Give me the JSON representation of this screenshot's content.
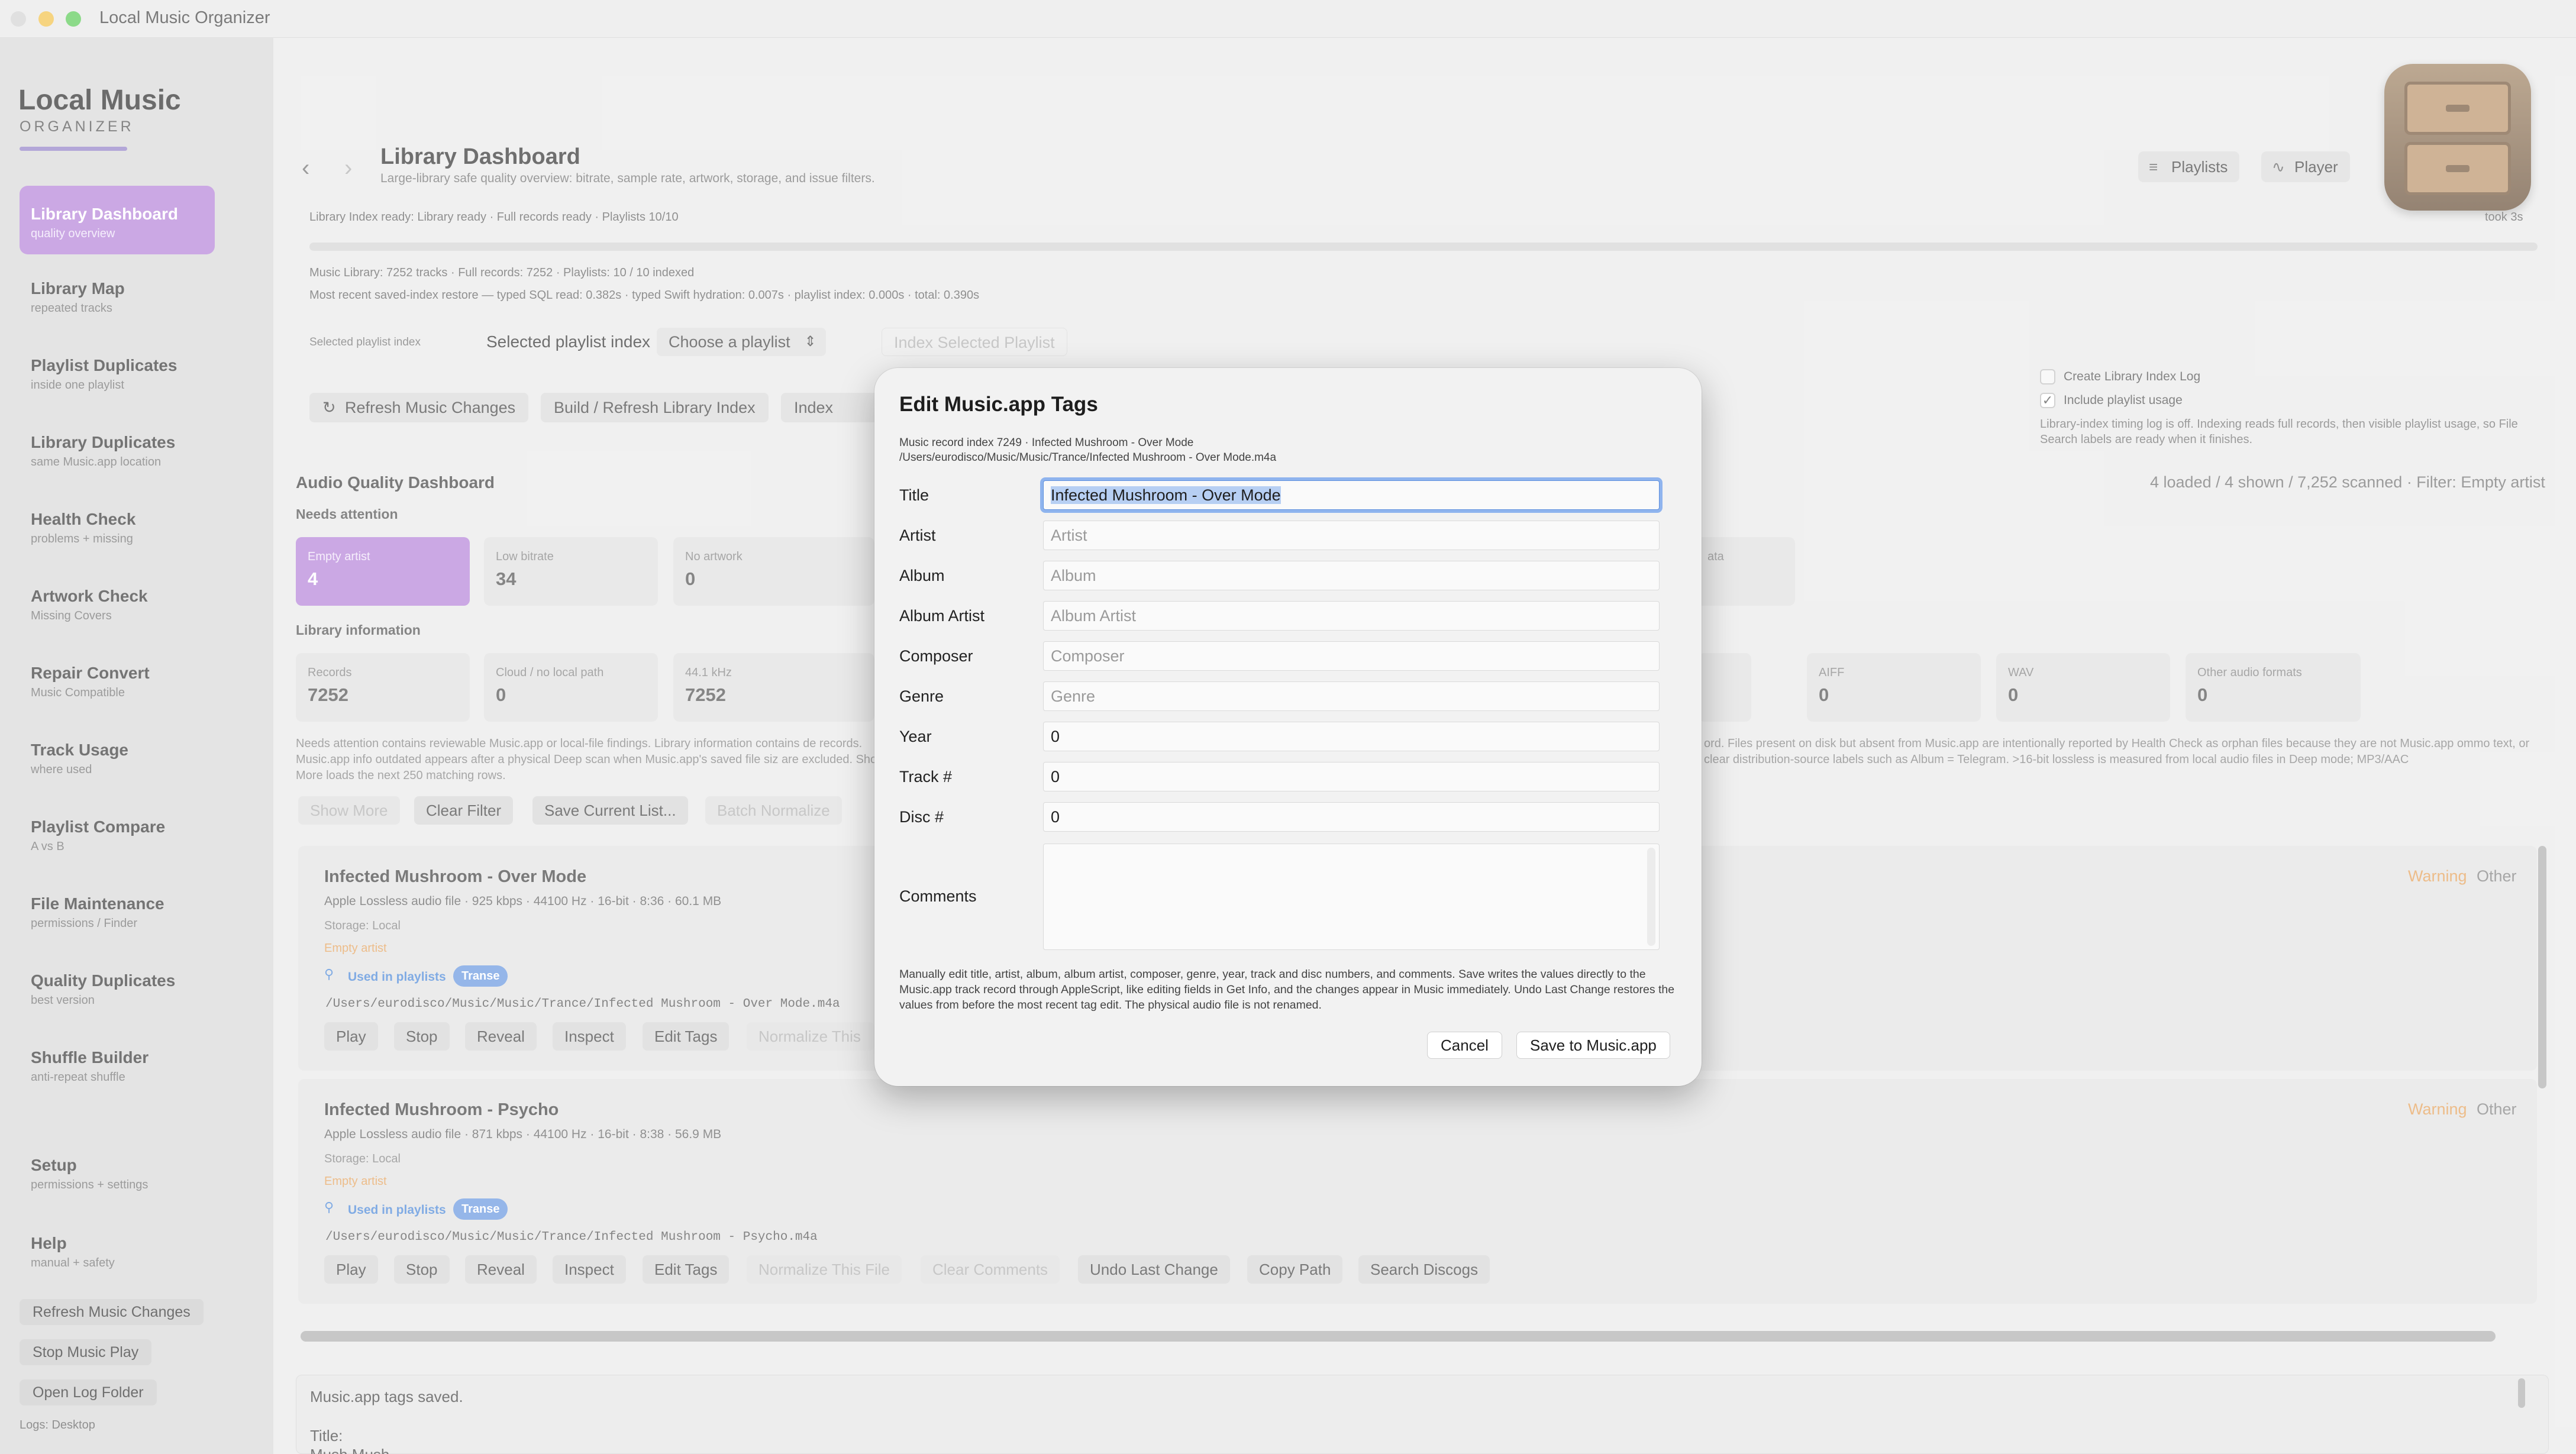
{
  "window": {
    "title": "Local Music Organizer"
  },
  "sidebar": {
    "brand_title": "Local Music",
    "brand_subtitle": "ORGANIZER",
    "items": [
      {
        "label": "Library Dashboard",
        "sub": "quality overview",
        "active": true
      },
      {
        "label": "Library Map",
        "sub": "repeated tracks"
      },
      {
        "label": "Playlist Duplicates",
        "sub": "inside one playlist"
      },
      {
        "label": "Library Duplicates",
        "sub": "same Music.app location"
      },
      {
        "label": "Health Check",
        "sub": "problems + missing"
      },
      {
        "label": "Artwork Check",
        "sub": "Missing Covers"
      },
      {
        "label": "Repair Convert",
        "sub": "Music Compatible"
      },
      {
        "label": "Track Usage",
        "sub": "where used"
      },
      {
        "label": "Playlist Compare",
        "sub": "A vs B"
      },
      {
        "label": "File Maintenance",
        "sub": "permissions / Finder"
      },
      {
        "label": "Quality Duplicates",
        "sub": "best version"
      },
      {
        "label": "Shuffle Builder",
        "sub": "anti-repeat shuffle"
      },
      {
        "label": "Setup",
        "sub": "permissions + settings"
      },
      {
        "label": "Help",
        "sub": "manual + safety"
      }
    ],
    "buttons": [
      "Refresh Music Changes",
      "Stop Music Play",
      "Open Log Folder"
    ],
    "logs_label": "Logs: Desktop"
  },
  "header": {
    "back_glyph": "‹",
    "forward_glyph": "›",
    "title": "Library Dashboard",
    "subtitle": "Large-library safe quality overview: bitrate, sample rate, artwork, storage, and issue filters.",
    "playlists_btn": "Playlists",
    "player_btn": "Player",
    "playlists_icon": "playlist-icon",
    "player_icon": "waveform-icon"
  },
  "index": {
    "status": "Library Index ready: Library ready · Full records ready · Playlists 10/10",
    "took": "took 3s",
    "library_info": "Music Library: 7252 tracks · Full records: 7252 · Playlists: 10 / 10 indexed",
    "restore_info": "Most recent saved-index restore — typed SQL read: 0.382s · typed Swift hydration: 0.007s · playlist index: 0.000s · total: 0.390s",
    "selected_label_small": "Selected playlist index",
    "selected_label": "Selected playlist index",
    "playlist_select": "Choose a playlist",
    "index_selected_btn": "Index Selected Playlist",
    "refresh_btn": "Refresh Music Changes",
    "build_btn": "Build / Refresh Library Index",
    "index_playlists_btn": "Index Playli",
    "create_log": "Create Library Index Log",
    "include_usage": "Include playlist usage",
    "note": "Library-index timing log is off. Indexing reads full records, then visible playlist usage, so File Search labels are ready when it finishes."
  },
  "quality": {
    "title": "Audio Quality Dashboard",
    "right_status": "4 loaded / 4 shown / 7,252 scanned · Filter: Empty artist",
    "needs_attention": "Needs attention",
    "attention_cards": [
      {
        "label": "Empty artist",
        "value": "4"
      },
      {
        "label": "Low bitrate",
        "value": "34"
      },
      {
        "label": "No artwork",
        "value": "0"
      }
    ],
    "partial_card_label": "ata",
    "library_information": "Library information",
    "info_cards": [
      {
        "label": "Records",
        "value": "7252"
      },
      {
        "label": "Cloud / no local path",
        "value": "0"
      },
      {
        "label": "44.1 kHz",
        "value": "7252"
      }
    ],
    "info_cards_right": [
      {
        "label": "AIFF",
        "value": "0"
      },
      {
        "label": "WAV",
        "value": "0"
      },
      {
        "label": "Other audio formats",
        "value": "0"
      }
    ],
    "note_left": "Needs attention contains reviewable Music.app or local-file findings. Library information contains de records. Music.app info outdated appears after a physical Deep scan when Music.app's saved file siz are excluded. Show More loads the next 250 matching rows.",
    "note_right": "ord. Files present on disk but absent from Music.app are intentionally reported by Health Check as orphan files because they are not Music.app ommo text, or clear distribution-source labels such as Album = Telegram. >16-bit lossless is measured from local audio files in Deep mode; MP3/AAC",
    "show_more": "Show More",
    "clear_filter": "Clear Filter",
    "save_list": "Save Current List...",
    "batch_normalize": "Batch Normalize"
  },
  "tracks": [
    {
      "title": "Infected Mushroom - Over Mode",
      "meta": "Apple Lossless audio file · 925 kbps · 44100 Hz · 16-bit · 8:36 · 60.1 MB",
      "storage": "Storage: Local",
      "issue": "Empty artist",
      "used": "Used in playlists",
      "tag": "Transe",
      "path": "/Users/eurodisco/Music/Music/Trance/Infected Mushroom - Over Mode.m4a",
      "warning": "Warning",
      "kind": "Other",
      "buttons": [
        "Play",
        "Stop",
        "Reveal",
        "Inspect",
        "Edit Tags",
        "Normalize This"
      ]
    },
    {
      "title": "Infected Mushroom - Psycho",
      "meta": "Apple Lossless audio file · 871 kbps · 44100 Hz · 16-bit · 8:38 · 56.9 MB",
      "storage": "Storage: Local",
      "issue": "Empty artist",
      "used": "Used in playlists",
      "tag": "Transe",
      "path": "/Users/eurodisco/Music/Music/Trance/Infected Mushroom - Psycho.m4a",
      "warning": "Warning",
      "kind": "Other",
      "buttons": [
        "Play",
        "Stop",
        "Reveal",
        "Inspect",
        "Edit Tags",
        "Normalize This File",
        "Clear Comments",
        "Undo Last Change",
        "Copy Path",
        "Search Discogs"
      ]
    }
  ],
  "log": {
    "line1": "Music.app tags saved.",
    "line2": "Title:",
    "line3": "Mush Mush"
  },
  "dialog": {
    "title": "Edit Music.app Tags",
    "sub1": "Music record index 7249 · Infected Mushroom - Over Mode",
    "sub2": "/Users/eurodisco/Music/Music/Trance/Infected Mushroom - Over Mode.m4a",
    "fields": [
      {
        "label": "Title",
        "value": "Infected Mushroom - Over Mode",
        "placeholder": ""
      },
      {
        "label": "Artist",
        "value": "",
        "placeholder": "Artist"
      },
      {
        "label": "Album",
        "value": "",
        "placeholder": "Album"
      },
      {
        "label": "Album Artist",
        "value": "",
        "placeholder": "Album Artist"
      },
      {
        "label": "Composer",
        "value": "",
        "placeholder": "Composer"
      },
      {
        "label": "Genre",
        "value": "",
        "placeholder": "Genre"
      },
      {
        "label": "Year",
        "value": "0",
        "placeholder": ""
      },
      {
        "label": "Track #",
        "value": "0",
        "placeholder": ""
      },
      {
        "label": "Disc #",
        "value": "0",
        "placeholder": ""
      }
    ],
    "comments_label": "Comments",
    "note": "Manually edit title, artist, album, album artist, composer, genre, year, track and disc numbers, and comments. Save writes the values directly to the Music.app track record through AppleScript, like editing fields in Get Info, and the changes appear in Music immediately. Undo Last Change restores the values from before the most recent tag edit. The physical audio file is not renamed.",
    "cancel": "Cancel",
    "save": "Save to Music.app"
  },
  "colors": {
    "accent": "#b07ad6",
    "warning": "#e3994a",
    "tag": "#5d8fdd"
  }
}
